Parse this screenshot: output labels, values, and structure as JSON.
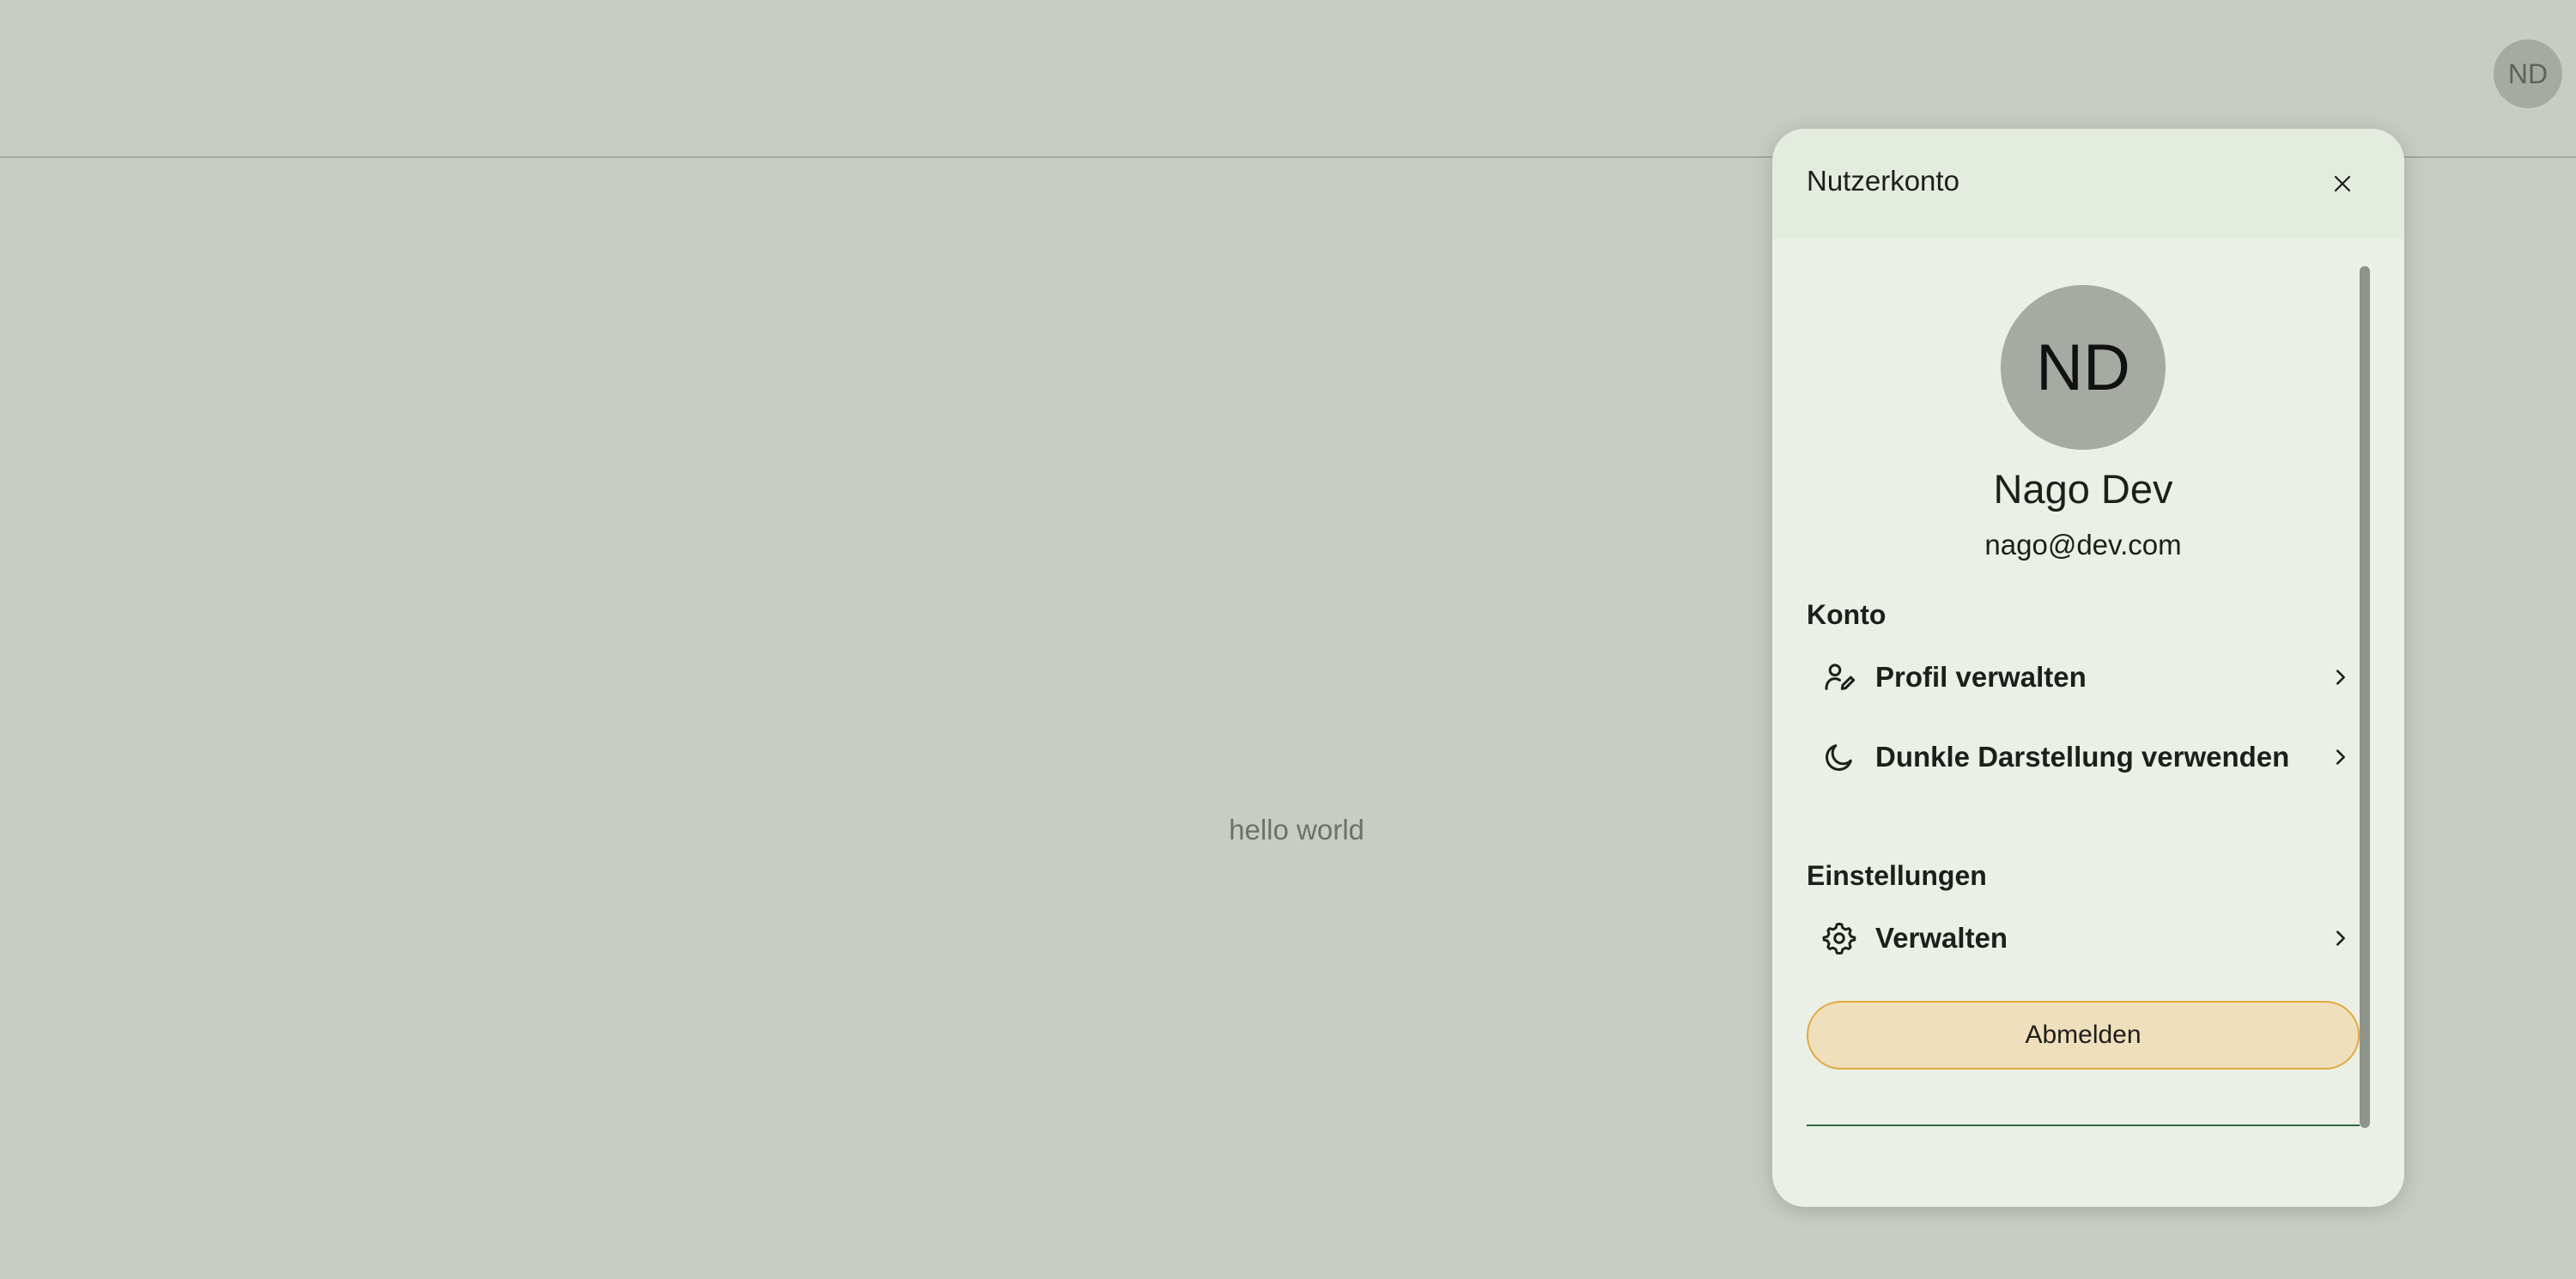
{
  "app": {
    "avatar_initials": "ND",
    "content_text": "hello world"
  },
  "account_panel": {
    "title": "Nutzerkonto",
    "close_icon": "close-icon",
    "avatar_initials": "ND",
    "user_name": "Nago Dev",
    "user_email": "nago@dev.com",
    "sections": [
      {
        "title": "Konto",
        "items": [
          {
            "label": "Profil verwalten",
            "icon": "user-edit-icon"
          },
          {
            "label": "Dunkle Darstellung verwenden",
            "icon": "moon-icon"
          }
        ]
      },
      {
        "title": "Einstellungen",
        "items": [
          {
            "label": "Verwalten",
            "icon": "gear-icon"
          }
        ]
      }
    ],
    "logout_label": "Abmelden"
  },
  "colors": {
    "background": "#c9ccc5",
    "panel": "#ebf0e6",
    "panel_header": "#e4ebdf",
    "avatar": "#a5aaa2",
    "logout_fill": "#efdfbc",
    "logout_border": "#e1a93d",
    "divider": "#2f6a3c"
  }
}
